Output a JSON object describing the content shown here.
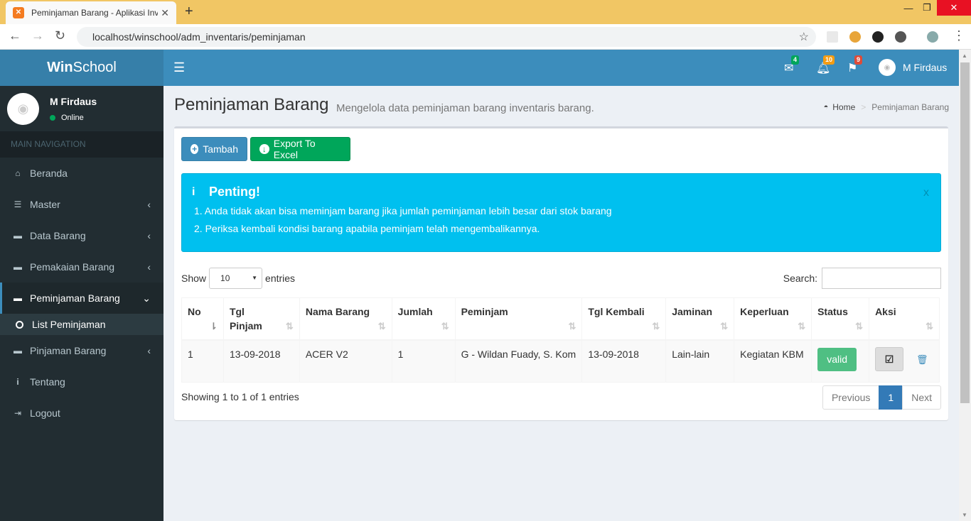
{
  "browser": {
    "tab_title": "Peminjaman Barang - Aplikasi Inv",
    "url": "localhost/winschool/adm_inventaris/peminjaman",
    "new_tab": "+"
  },
  "app": {
    "logo_bold": "Win",
    "logo_rest": "School"
  },
  "topbar": {
    "mail_count": "4",
    "bell_count": "10",
    "flag_count": "9",
    "user_name": "M Firdaus",
    "colors": {
      "green": "#00a65a",
      "orange": "#f39c12",
      "red": "#dd4b39"
    }
  },
  "sidebar": {
    "user_name": "M Firdaus",
    "status": "Online",
    "nav_header": "MAIN NAVIGATION",
    "items": [
      {
        "label": "Beranda",
        "icon": "home-icon"
      },
      {
        "label": "Master",
        "icon": "list-icon"
      },
      {
        "label": "Data Barang",
        "icon": "briefcase-icon"
      },
      {
        "label": "Pemakaian Barang",
        "icon": "briefcase-icon"
      },
      {
        "label": "Peminjaman Barang",
        "icon": "briefcase-icon"
      },
      {
        "label": "Pinjaman Barang",
        "icon": "briefcase-icon"
      },
      {
        "label": "Tentang",
        "icon": "info-icon"
      },
      {
        "label": "Logout",
        "icon": "sign-out-icon"
      }
    ],
    "submenu_label": "List Peminjaman"
  },
  "header": {
    "title": "Peminjaman Barang",
    "subtitle": "Mengelola data peminjaman barang inventaris barang.",
    "breadcrumb_home": "Home",
    "breadcrumb_current": "Peminjaman Barang"
  },
  "toolbar": {
    "add_label": "Tambah",
    "export_label": "Export To Excel"
  },
  "alert": {
    "title": "Penting!",
    "line1": "1. Anda tidak akan bisa meminjam barang jika jumlah peminjaman lebih besar dari stok barang",
    "line2": "2. Periksa kembali kondisi barang apabila peminjam telah mengembalikannya.",
    "close": "x"
  },
  "table_controls": {
    "show_label": "Show",
    "entries_value": "10",
    "entries_label": "entries",
    "search_label": "Search:"
  },
  "table": {
    "headers": [
      "No",
      "Tgl Pinjam",
      "Nama Barang",
      "Jumlah",
      "Peminjam",
      "Tgl Kembali",
      "Jaminan",
      "Keperluan",
      "Status",
      "Aksi"
    ],
    "rows": [
      {
        "no": "1",
        "tgl_pinjam": "13-09-2018",
        "nama_barang": "ACER V2",
        "jumlah": "1",
        "peminjam": "G - Wildan Fuady, S. Kom",
        "tgl_kembali": "13-09-2018",
        "jaminan": "Lain-lain",
        "keperluan": "Kegiatan KBM",
        "status": "valid"
      }
    ]
  },
  "footer": {
    "info": "Showing 1 to 1 of 1 entries",
    "prev": "Previous",
    "page": "1",
    "next": "Next"
  }
}
